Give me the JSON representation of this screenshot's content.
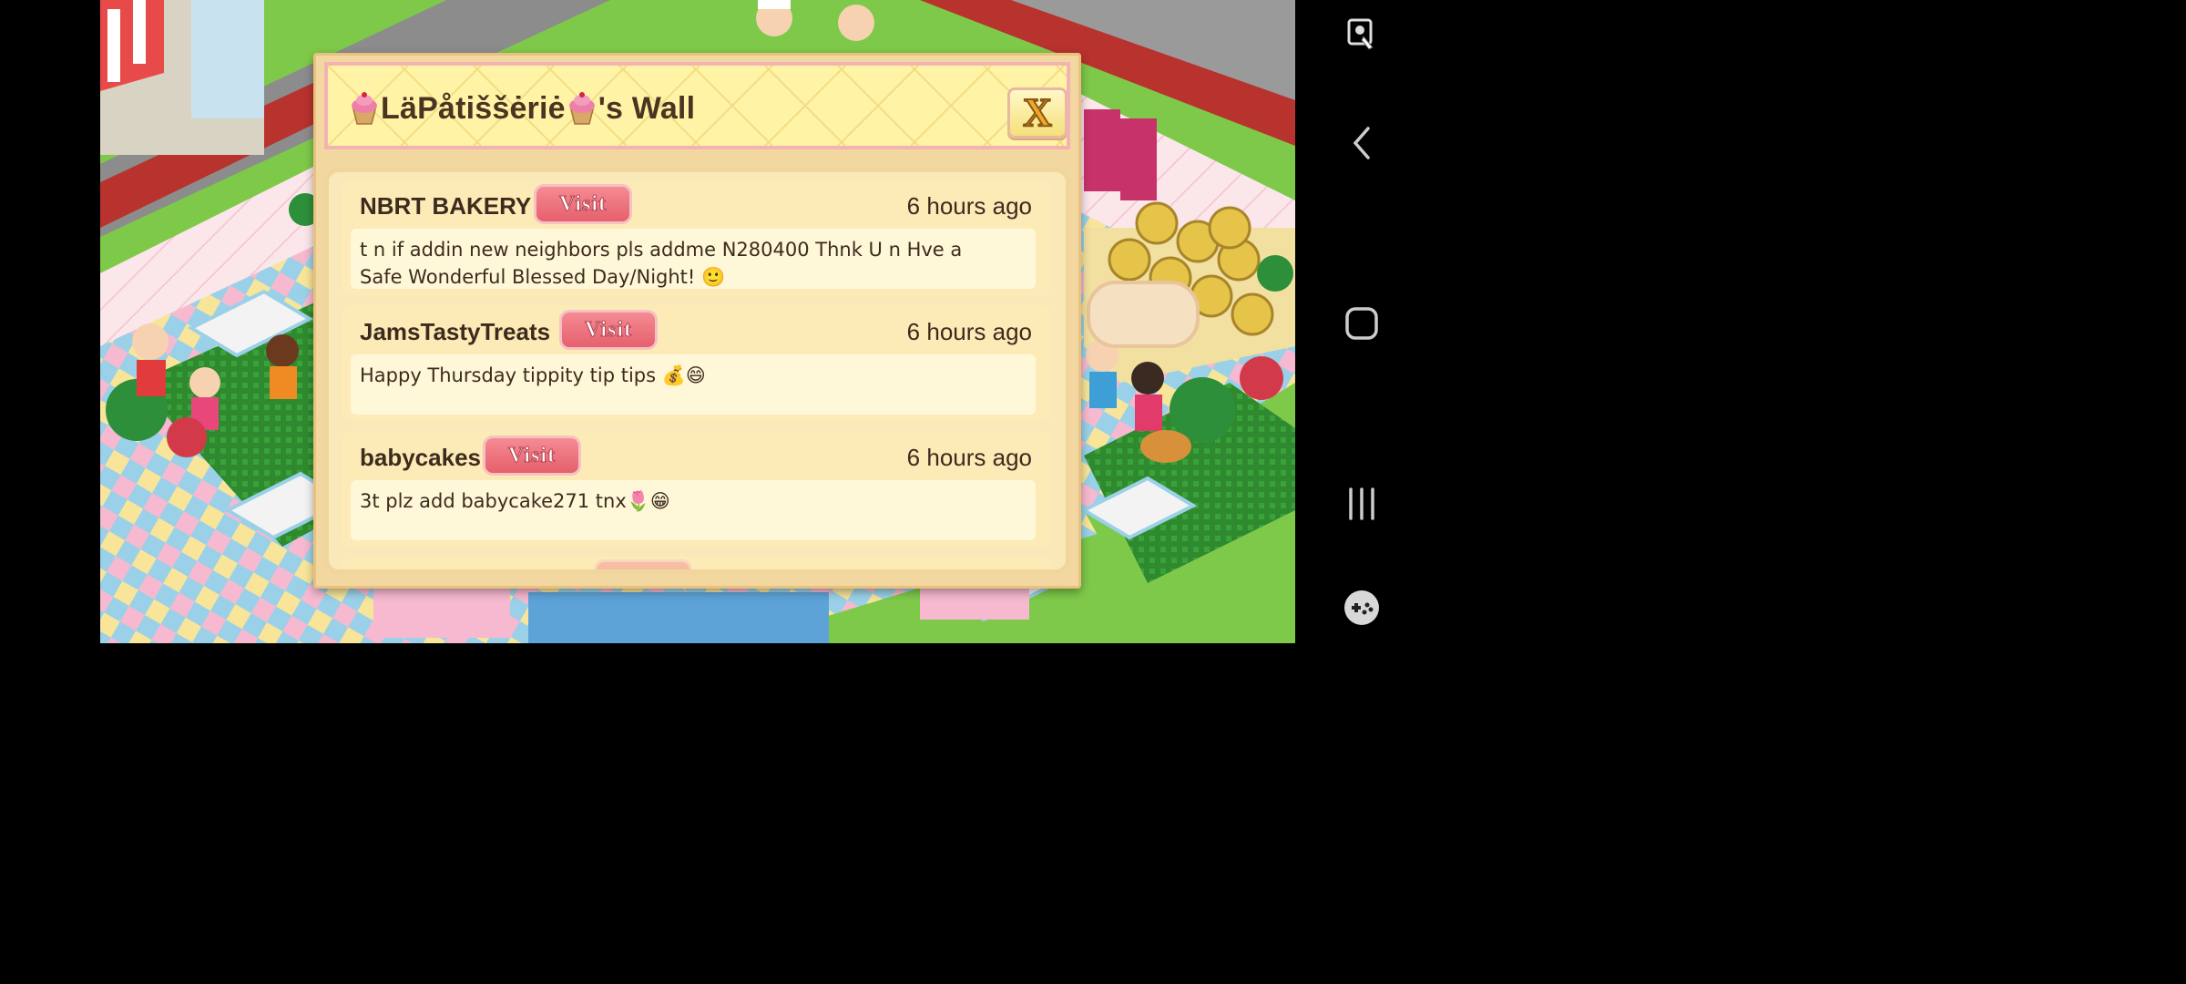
{
  "dialog": {
    "title_parts": [
      "LäPåtišš",
      "ėriė",
      "'s Wall"
    ],
    "title_text": "LäPåtiššėriė",
    "title_suffix": "'s Wall",
    "close_label": "X"
  },
  "posts": [
    {
      "author": "NBRT BAKERY",
      "visit_label": "Visit",
      "time": "6 hours ago",
      "message_line1": "t n if addin new neighbors pls addme N280400 Thnk U n Hve a",
      "message_line2": "Safe Wonderful Blessed Day/Night! 🙂"
    },
    {
      "author": "JamsTastyTreats",
      "visit_label": "Visit",
      "time": "6 hours ago",
      "message_line1": "Happy Thursday tippity tip tips 💰😄",
      "message_line2": ""
    },
    {
      "author": "babycakes",
      "visit_label": "Visit",
      "time": "6 hours ago",
      "message_line1": "3t plz add babycake271 tnx🌷😁",
      "message_line2": ""
    }
  ],
  "nav": {
    "icons": [
      "accessibility-icon",
      "back-icon",
      "home-icon",
      "recents-icon",
      "game-tools-icon"
    ]
  },
  "colors": {
    "header_bg": "#fff4a6",
    "panel_bg": "#f2d7a0",
    "visit_button": "#e5606c",
    "text": "#3d2b1e"
  }
}
